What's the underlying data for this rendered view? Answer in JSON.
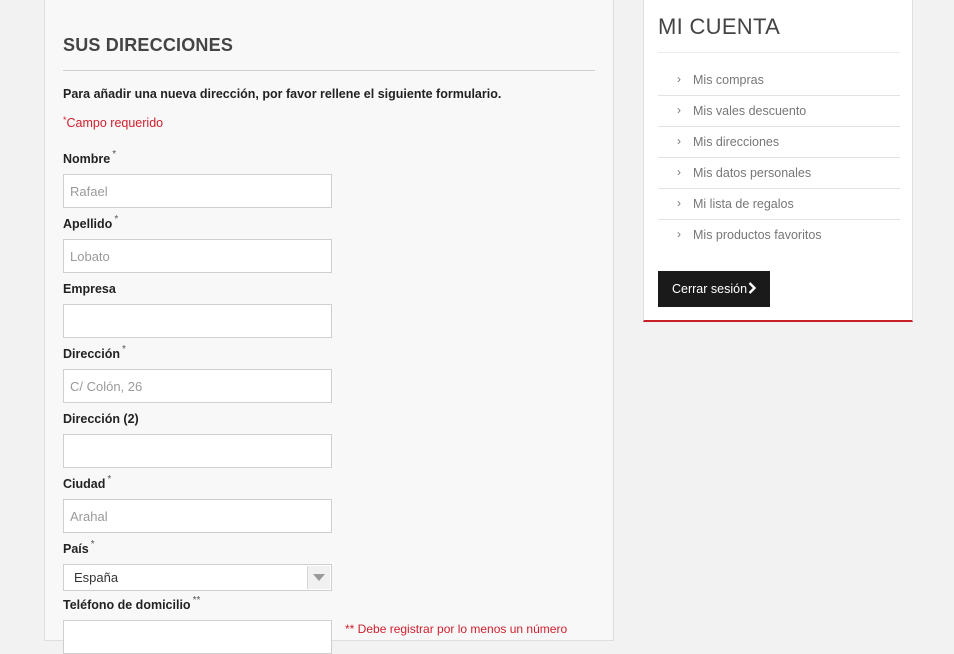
{
  "form": {
    "title": "SUS DIRECCIONES",
    "intro": "Para añadir una nueva dirección, por favor rellene el siguiente formulario.",
    "required_star": "*",
    "required_note": "Campo requerido",
    "fields": {
      "nombre": {
        "label": "Nombre",
        "req": "*",
        "placeholder": "Rafael",
        "value": ""
      },
      "apellido": {
        "label": "Apellido",
        "req": "*",
        "placeholder": "Lobato",
        "value": ""
      },
      "empresa": {
        "label": "Empresa",
        "placeholder": "",
        "value": ""
      },
      "direccion": {
        "label": "Dirección",
        "req": "*",
        "placeholder": "C/ Colón, 26",
        "value": ""
      },
      "direccion2": {
        "label": "Dirección (2)",
        "placeholder": "",
        "value": ""
      },
      "ciudad": {
        "label": "Ciudad",
        "req": "*",
        "placeholder": "Arahal",
        "value": ""
      },
      "pais": {
        "label": "País",
        "req": "*",
        "selected": "España"
      },
      "telefono": {
        "label": "Teléfono de domicilio",
        "req": "**",
        "placeholder": "",
        "value": ""
      }
    },
    "phone_note": "** Debe registrar por lo menos un número"
  },
  "account": {
    "title": "MI CUENTA",
    "menu": [
      {
        "label": "Mis compras",
        "icon": "chevron-right-icon"
      },
      {
        "label": "Mis vales descuento",
        "icon": "chevron-right-icon"
      },
      {
        "label": "Mis direcciones",
        "icon": "chevron-right-icon"
      },
      {
        "label": "Mis datos personales",
        "icon": "chevron-right-icon"
      },
      {
        "label": "Mi lista de regalos",
        "icon": "chevron-right-icon"
      },
      {
        "label": "Mis productos favoritos",
        "icon": "chevron-right-icon"
      }
    ],
    "logout_label": "Cerrar sesión"
  },
  "colors": {
    "accent_red": "#d0202e",
    "button_dark": "#1a1a1a"
  }
}
